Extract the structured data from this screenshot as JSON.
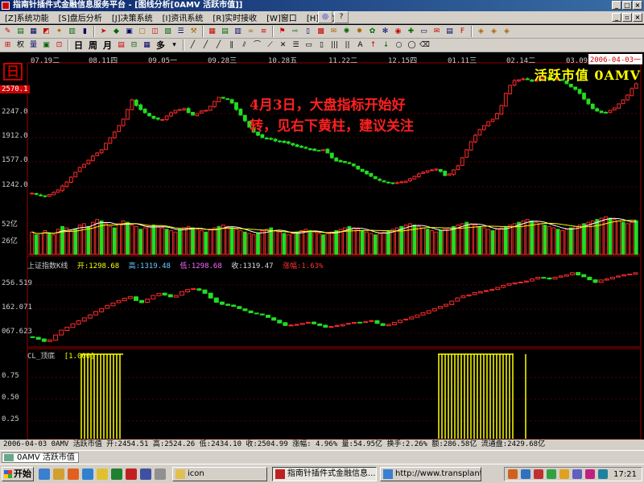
{
  "window": {
    "title": "指南针插件式金融信息服务平台 - [图线分析[0AMV 活跃市值]]"
  },
  "menu": {
    "items": [
      "[Z]系统功能",
      "[S]盘后分析",
      "[J]决策系统",
      "[I]资讯系统",
      "[R]实时接收",
      "[W]窗口",
      "[H]帮助"
    ],
    "help_icon": "?"
  },
  "toolbar2": {
    "labels": [
      "日",
      "周",
      "月"
    ],
    "multi_label": "多"
  },
  "chart": {
    "dates": [
      "07.19二",
      "08.11四",
      "09.05一",
      "09.28三",
      "10.28五",
      "11.22二",
      "12.15四",
      "01.11三",
      "02.14二",
      "03.09四"
    ],
    "end_date": "2006-04-03一",
    "period_label": "日",
    "index_name": "活跃市值 0AMV",
    "price_top_tag": "2570.1",
    "price_labels": [
      "2247.0",
      "1912.0",
      "1577.0",
      "1242.0"
    ],
    "volume_labels": [
      "52亿",
      "26亿"
    ],
    "annotation_line1": "4月3日，大盘指标开始好",
    "annotation_line2": "转，见右下黄柱，建议关注",
    "panel2": {
      "name": "上证指数K线",
      "open": "开:1298.68",
      "high": "高:1319.48",
      "low": "低:1298.68",
      "close": "收:1319.47",
      "change": "涨幅:1.63%",
      "labels": [
        "256.519",
        "162.071",
        "067.623"
      ]
    },
    "panel3": {
      "name": "CL_顶底",
      "value": "[1.000]",
      "labels": [
        "0.75",
        "0.50",
        "0.25"
      ]
    }
  },
  "colors": {
    "up": "#ff2a2a",
    "down": "#22dd22",
    "ma1": "#ffffff",
    "ma2": "#ffff00",
    "grid": "#990000",
    "signal": "#ffff00"
  },
  "status": {
    "text": "2006-04-03 0AMV 活跃市值 开:2454.51 高:2524.26 低:2434.10 收:2504.99 涨幅: 4.96% 量:54.95亿 换手:2.26% 额:286.58亿 流通盘:2429.68亿"
  },
  "tab": {
    "label": "0AMV 活跃市值"
  },
  "taskbar": {
    "start_label": "开始",
    "tasks": [
      {
        "label": "icon"
      },
      {
        "label": "指南针插件式金融信息..."
      },
      {
        "label": "http://www.transplantati..."
      }
    ],
    "clock": "17:21"
  },
  "series": {
    "close": [
      1060,
      1045,
      1030,
      1020,
      1045,
      1070,
      1100,
      1150,
      1200,
      1260,
      1320,
      1380,
      1420,
      1470,
      1520,
      1560,
      1600,
      1680,
      1750,
      1820,
      1900,
      1980,
      2100,
      2220,
      2150,
      2100,
      2060,
      2020,
      1990,
      1980,
      1975,
      2020,
      2060,
      2090,
      2100,
      2110,
      2060,
      2030,
      2050,
      2080,
      2090,
      2140,
      2200,
      2250,
      2240,
      2230,
      2180,
      2100,
      2030,
      1960,
      1880,
      1820,
      1780,
      1750,
      1740,
      1730,
      1710,
      1700,
      1690,
      1680,
      1660,
      1640,
      1630,
      1620,
      1600,
      1590,
      1590,
      1600,
      1560,
      1500,
      1460,
      1450,
      1440,
      1430,
      1400,
      1360,
      1330,
      1300,
      1270,
      1240,
      1220,
      1200,
      1190,
      1180,
      1190,
      1200,
      1210,
      1240,
      1270,
      1300,
      1320,
      1340,
      1350,
      1360,
      1330,
      1280,
      1300,
      1350,
      1400,
      1500,
      1600,
      1700,
      1780,
      1850,
      1900,
      1950,
      1980,
      2050,
      2150,
      2300,
      2400,
      2460,
      2470,
      2480,
      2470,
      2450,
      2470,
      2490,
      2500,
      2480,
      2470,
      2480,
      2460,
      2420,
      2380,
      2350,
      2300,
      2230,
      2170,
      2110,
      2080,
      2060,
      2060,
      2090,
      2120,
      2170,
      2220,
      2280,
      2360,
      2420
    ],
    "sh_close": [
      1015,
      1005,
      995,
      1002,
      1025,
      1048,
      1062,
      1078,
      1092,
      1106,
      1120,
      1136,
      1150,
      1165,
      1176,
      1188,
      1199,
      1207,
      1188,
      1178,
      1195,
      1212,
      1222,
      1214,
      1205,
      1212,
      1230,
      1240,
      1244,
      1237,
      1222,
      1200,
      1180,
      1170,
      1165,
      1160,
      1150,
      1140,
      1130,
      1125,
      1120,
      1108,
      1095,
      1082,
      1070,
      1072,
      1075,
      1080,
      1085,
      1078,
      1070,
      1062,
      1065,
      1070,
      1075,
      1080,
      1084,
      1083,
      1088,
      1093,
      1080,
      1070,
      1075,
      1085,
      1095,
      1100,
      1110,
      1120,
      1130,
      1140,
      1150,
      1160,
      1170,
      1185,
      1200,
      1210,
      1215,
      1225,
      1230,
      1235,
      1240,
      1250,
      1260,
      1268,
      1272,
      1275,
      1280,
      1290,
      1298,
      1296,
      1290,
      1298,
      1304,
      1310,
      1319,
      1309,
      1300,
      1286,
      1274,
      1285,
      1290,
      1298,
      1304,
      1310,
      1313,
      1319
    ],
    "volume": [
      32,
      28,
      30,
      34,
      30,
      28,
      36,
      40,
      38,
      34,
      36,
      42,
      44,
      40,
      46,
      50,
      48,
      44,
      40,
      38,
      44,
      48,
      46,
      42,
      40,
      36,
      38,
      40,
      42,
      40,
      38,
      36,
      34,
      32,
      36,
      38,
      40,
      38,
      36,
      34,
      32,
      36,
      38,
      40,
      42,
      40,
      38,
      36,
      34,
      32,
      30,
      28,
      30,
      34,
      36,
      38,
      34,
      32,
      30,
      28,
      30,
      32,
      34,
      36,
      34,
      32,
      30,
      28,
      30,
      32,
      34,
      36,
      38,
      40,
      38,
      36,
      34,
      32,
      30,
      28,
      30,
      32,
      34,
      36,
      38,
      40,
      42,
      44,
      42,
      40,
      38,
      36,
      34,
      32,
      34,
      36,
      38,
      40,
      42,
      44,
      46,
      44,
      42,
      40,
      38,
      36,
      34,
      36,
      38,
      40,
      42,
      44,
      46,
      48,
      50,
      48,
      46,
      44,
      42,
      40,
      38,
      36,
      34,
      36,
      38,
      40,
      42,
      44,
      46,
      48,
      50,
      52,
      54,
      52,
      50,
      48,
      46,
      44,
      46,
      48
    ],
    "signal_left": [
      101,
      105,
      109,
      113,
      117,
      121,
      125,
      129,
      133,
      137,
      141,
      145,
      149
    ],
    "signal_right": [
      545,
      549,
      553,
      557,
      561,
      565,
      569,
      573,
      577,
      581,
      585,
      589,
      593,
      597,
      601,
      605,
      609,
      613,
      617,
      621,
      625,
      629,
      633,
      637,
      653
    ]
  }
}
